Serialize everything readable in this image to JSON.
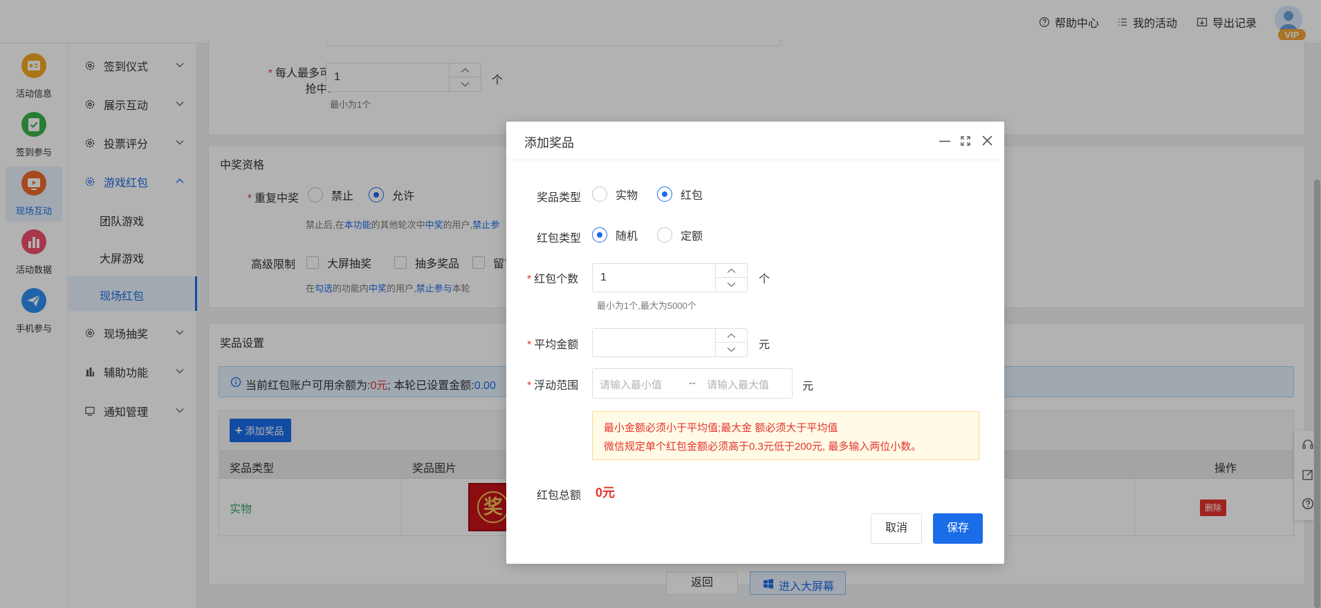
{
  "topnav": {
    "help": "帮助中心",
    "activities": "我的活动",
    "export": "导出记录",
    "vip": "VIP"
  },
  "rail": [
    {
      "label": "活动信息",
      "icon": "activity-info-icon",
      "color": "#f5a623"
    },
    {
      "label": "签到参与",
      "icon": "checkin-icon",
      "color": "#3cb34a"
    },
    {
      "label": "现场互动",
      "icon": "live-interact-icon",
      "color": "#f0672b"
    },
    {
      "label": "活动数据",
      "icon": "activity-data-icon",
      "color": "#f0506e"
    },
    {
      "label": "手机参与",
      "icon": "mobile-join-icon",
      "color": "#2f8ef0"
    }
  ],
  "submenu": {
    "groups": [
      "签到仪式",
      "展示互动",
      "投票评分",
      "游戏红包"
    ],
    "children": [
      "团队游戏",
      "大屏游戏",
      "现场红包"
    ],
    "groups2": [
      "现场抽奖",
      "辅助功能",
      "通知管理"
    ]
  },
  "form": {
    "max_win_label_1": "每人最多可",
    "max_win_label_2": "抢中:",
    "max_win_value": "1",
    "max_win_unit": "个",
    "max_win_hint": "最小为1个"
  },
  "qualify": {
    "title": "中奖资格",
    "repeat_label": "重复中奖",
    "opt_forbid": "禁止",
    "opt_allow": "允许",
    "hint_1": "禁止后,在",
    "hint_2": "本功能",
    "hint_3": "的其他轮次中",
    "hint_4": "中奖",
    "hint_5": "的用户,",
    "hint_6": "禁止参",
    "adv_label": "高级限制",
    "adv_opts": [
      "大屏抽奖",
      "抽多奖品",
      "留言抽"
    ],
    "adv_hint_1": "在",
    "adv_hint_2": "勾选",
    "adv_hint_3": "的功能内",
    "adv_hint_4": "中奖",
    "adv_hint_5": "的用户,",
    "adv_hint_6": "禁止参与",
    "adv_hint_7": "本轮"
  },
  "prize": {
    "title": "奖品设置",
    "info_1": "当前红包账户可用余额为:",
    "info_2": "0元",
    "info_3": "; 本轮已设置金额:",
    "info_4": "0.00",
    "add_btn": "添加奖品",
    "col_type": "奖品类型",
    "col_image": "奖品图片",
    "col_action": "操作",
    "row_type": "实物",
    "row_image_char": "奖",
    "delete_btn": "删除"
  },
  "footer": {
    "back": "返回",
    "enter_screen": "进入大屏幕"
  },
  "dialog": {
    "title": "添加奖品",
    "prize_type_label": "奖品类型",
    "prize_type_opts": [
      "实物",
      "红包"
    ],
    "prize_type_selected": "红包",
    "rp_type_label": "红包类型",
    "rp_type_opts": [
      "随机",
      "定额"
    ],
    "rp_type_selected": "随机",
    "count_label": "红包个数",
    "count_value": "1",
    "count_unit": "个",
    "count_hint": "最小为1个,最大为5000个",
    "avg_label": "平均金额",
    "avg_value": "",
    "avg_unit": "元",
    "range_label": "浮动范围",
    "range_min_ph": "请输入最小值",
    "range_sep": "--",
    "range_max_ph": "请输入最大值",
    "range_unit": "元",
    "warn_1": "最小金额必须小于平均值;最大金 额必须大于平均值",
    "warn_2": "微信规定单个红包金额必须高于0.3元低于200元, 最多输入两位小数。",
    "total_label": "红包总额",
    "total_value": "0元",
    "cancel": "取消",
    "save": "保存"
  },
  "colors": {
    "primary": "#1a6ce8",
    "danger": "#e5322c",
    "success": "#3aa36b",
    "warn_bg": "#fffbe6"
  }
}
